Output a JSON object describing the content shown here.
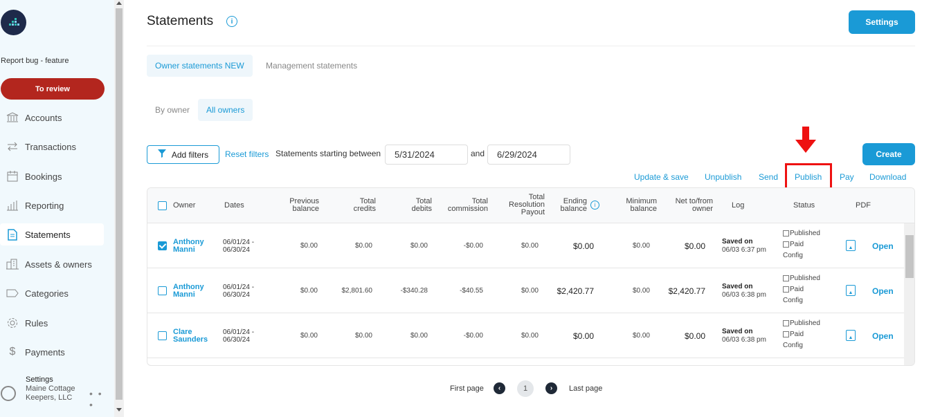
{
  "sidebar": {
    "report_bug": "Report bug - feature",
    "review_button": "To review",
    "items": [
      {
        "label": "Accounts",
        "icon": "bank-icon"
      },
      {
        "label": "Transactions",
        "icon": "arrows-exchange-icon"
      },
      {
        "label": "Bookings",
        "icon": "calendar-icon"
      },
      {
        "label": "Reporting",
        "icon": "bar-chart-icon"
      },
      {
        "label": "Statements",
        "icon": "document-icon"
      },
      {
        "label": "Assets & owners",
        "icon": "building-icon"
      },
      {
        "label": "Categories",
        "icon": "tag-icon"
      },
      {
        "label": "Rules",
        "icon": "gear-icon"
      },
      {
        "label": "Payments",
        "icon": "dollar-icon"
      }
    ],
    "user": {
      "settings_label": "Settings",
      "company": "Maine Cottage Keepers, LLC"
    }
  },
  "header": {
    "title": "Statements",
    "settings_button": "Settings"
  },
  "tabs": {
    "primary": [
      "Owner statements NEW",
      "Management statements"
    ],
    "secondary": [
      "By owner",
      "All owners"
    ]
  },
  "filters": {
    "add_filters": "Add filters",
    "reset_filters": "Reset filters",
    "between_label": "Statements starting between",
    "start_date": "5/31/2024",
    "and_label": "and",
    "end_date": "6/29/2024",
    "create_button": "Create"
  },
  "actions": [
    "Update & save",
    "Unpublish",
    "Send",
    "Publish",
    "Pay",
    "Download"
  ],
  "table": {
    "headers": {
      "owner": "Owner",
      "dates": "Dates",
      "previous_balance": [
        "Previous",
        "balance"
      ],
      "total_credits": [
        "Total",
        "credits"
      ],
      "total_debits": [
        "Total",
        "debits"
      ],
      "total_commission": [
        "Total",
        "commission"
      ],
      "total_resolution": [
        "Total",
        "Resolution",
        "Payout"
      ],
      "ending_balance": [
        "Ending",
        "balance"
      ],
      "minimum_balance": [
        "Minimum",
        "balance"
      ],
      "net": [
        "Net to/from",
        "owner"
      ],
      "log": "Log",
      "status": "Status",
      "pdf": "PDF"
    },
    "rows": [
      {
        "owner": [
          "Anthony",
          "Manni"
        ],
        "dates": [
          "06/01/24 -",
          "06/30/24"
        ],
        "previous": "$0.00",
        "credits": "$0.00",
        "debits": "$0.00",
        "commission": "-$0.00",
        "resolution": "$0.00",
        "ending": "$0.00",
        "minimum": "$0.00",
        "net": "$0.00",
        "log_status": "Saved on",
        "log_date": "06/03 6:37 pm",
        "status": [
          "Published",
          "Paid",
          "Config"
        ],
        "open": "Open",
        "checked": true
      },
      {
        "owner": [
          "Anthony",
          "Manni"
        ],
        "dates": [
          "06/01/24 -",
          "06/30/24"
        ],
        "previous": "$0.00",
        "credits": "$2,801.60",
        "debits": "-$340.28",
        "commission": "-$40.55",
        "resolution": "$0.00",
        "ending": "$2,420.77",
        "minimum": "$0.00",
        "net": "$2,420.77",
        "log_status": "Saved on",
        "log_date": "06/03 6:38 pm",
        "status": [
          "Published",
          "Paid",
          "Config"
        ],
        "open": "Open",
        "checked": false
      },
      {
        "owner": [
          "Clare",
          "Saunders"
        ],
        "dates": [
          "06/01/24 -",
          "06/30/24"
        ],
        "previous": "$0.00",
        "credits": "$0.00",
        "debits": "$0.00",
        "commission": "-$0.00",
        "resolution": "$0.00",
        "ending": "$0.00",
        "minimum": "$0.00",
        "net": "$0.00",
        "log_status": "Saved on",
        "log_date": "06/03 6:38 pm",
        "status": [
          "Published",
          "Paid",
          "Config"
        ],
        "open": "Open",
        "checked": false
      }
    ]
  },
  "pagination": {
    "first": "First page",
    "current": "1",
    "last": "Last page"
  },
  "colors": {
    "accent": "#1a9ad6",
    "review": "#b3261e",
    "highlight": "#ee1111"
  }
}
